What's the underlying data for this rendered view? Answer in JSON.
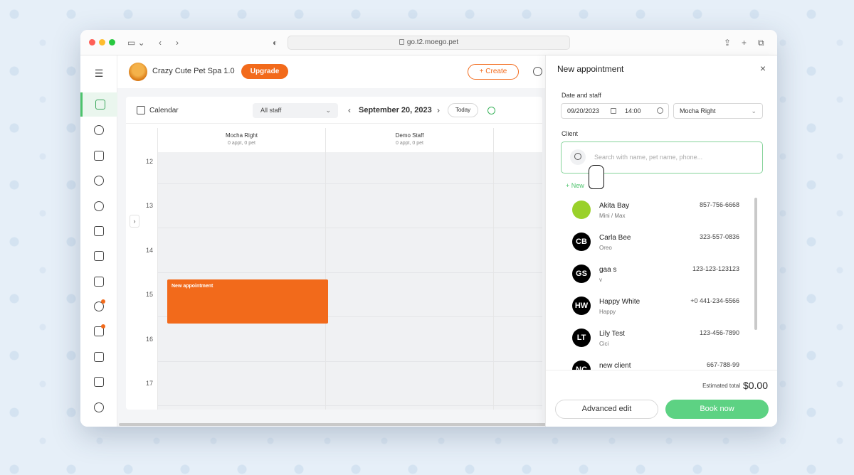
{
  "browser": {
    "url": "go.t2.moego.pet"
  },
  "colors": {
    "accent_orange": "#f26a1b",
    "accent_green": "#5dd283",
    "background": "#e6eff8"
  },
  "sidebar": {
    "items": [
      {
        "icon": "menu-icon"
      },
      {
        "icon": "calendar-icon",
        "active": true
      },
      {
        "icon": "pet-icon"
      },
      {
        "icon": "bag-icon"
      },
      {
        "icon": "chat-icon"
      },
      {
        "icon": "alarm-icon"
      },
      {
        "icon": "schedule-icon"
      },
      {
        "icon": "clipboard-icon"
      },
      {
        "icon": "report-icon"
      },
      {
        "icon": "payment-icon",
        "badge": true
      },
      {
        "icon": "megaphone-icon",
        "badge": true
      },
      {
        "icon": "crown-icon"
      },
      {
        "icon": "chart-icon"
      },
      {
        "icon": "settings-icon"
      }
    ]
  },
  "header": {
    "business_name": "Crazy Cute Pet Spa 1.0",
    "upgrade_label": "Upgrade",
    "create_label": "+ Create"
  },
  "calendar": {
    "title": "Calendar",
    "staff_filter": "All staff",
    "date": "September 20, 2023",
    "today_label": "Today",
    "columns": [
      {
        "name": "Mocha Right",
        "summary": "0 appt, 0 pet"
      },
      {
        "name": "Demo Staff",
        "summary": "0 appt, 0 pet"
      }
    ],
    "hours": [
      "12",
      "13",
      "14",
      "15",
      "16",
      "17"
    ],
    "appointment_label": "New appointment"
  },
  "panel": {
    "title": "New appointment",
    "date_staff_label": "Date and staff",
    "date_value": "09/20/2023",
    "time_value": "14:00",
    "staff_value": "Mocha Right",
    "client_label": "Client",
    "search_placeholder": "Search with name, pet name, phone...",
    "new_client_label": "+ New",
    "clients": [
      {
        "initials": "",
        "name": "Akita Bay",
        "pets": "Mini / Max",
        "phone": "857-756-6668"
      },
      {
        "initials": "CB",
        "name": "Carla Bee",
        "pets": "Oreo",
        "phone": "323-557-0836"
      },
      {
        "initials": "GS",
        "name": "gaa s",
        "pets": "v",
        "phone": "123-123-123123"
      },
      {
        "initials": "HW",
        "name": "Happy White",
        "pets": "Happy",
        "phone": "+0 441-234-5566"
      },
      {
        "initials": "LT",
        "name": "Lily Test",
        "pets": "Cici",
        "phone": "123-456-7890"
      },
      {
        "initials": "NC",
        "name": "new client",
        "pets": "",
        "phone": "667-788-99"
      }
    ],
    "estimated_total_label": "Estimated total",
    "estimated_total_value": "$0.00",
    "advanced_edit_label": "Advanced edit",
    "book_now_label": "Book now"
  }
}
